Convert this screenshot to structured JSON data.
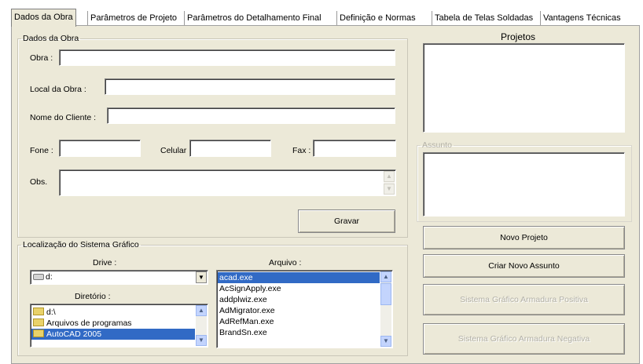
{
  "tabs": [
    {
      "label": "Dados da Obra",
      "active": true
    },
    {
      "label": "Parâmetros de Projeto"
    },
    {
      "label": "Parâmetros do Detalhamento Final"
    },
    {
      "label": "Definição e Normas"
    },
    {
      "label": "Tabela de Telas Soldadas"
    },
    {
      "label": "Vantagens Técnicas"
    }
  ],
  "obra_group": {
    "legend": "Dados da Obra",
    "obra_label": "Obra :",
    "local_label": "Local da Obra :",
    "cliente_label": "Nome do Cliente :",
    "fone_label": "Fone :",
    "celular_label": "Celular :",
    "fax_label": "Fax :",
    "obs_label": "Obs.",
    "values": {
      "obra": "",
      "local": "",
      "cliente": "",
      "fone": "",
      "celular": "",
      "fax": "",
      "obs": ""
    },
    "gravar_button": "Gravar"
  },
  "localizacao": {
    "legend": "Localização do Sistema Gráfico",
    "drive_label": "Drive :",
    "drive_value": "d:",
    "diretorio_label": "Diretório :",
    "directories": [
      {
        "label": "d:\\",
        "selected": false
      },
      {
        "label": "Arquivos de programas",
        "selected": false
      },
      {
        "label": "AutoCAD 2005",
        "selected": true
      }
    ],
    "arquivo_label": "Arquivo :",
    "files": [
      {
        "label": "acad.exe",
        "selected": true
      },
      {
        "label": "AcSignApply.exe",
        "selected": false
      },
      {
        "label": "addplwiz.exe",
        "selected": false
      },
      {
        "label": "AdMigrator.exe",
        "selected": false
      },
      {
        "label": "AdRefMan.exe",
        "selected": false
      },
      {
        "label": "BrandSn.exe",
        "selected": false
      }
    ]
  },
  "right": {
    "projetos_title": "Projetos",
    "assunto_legend": "Assunto",
    "novo_projeto_button": "Novo Projeto",
    "criar_assunto_button": "Criar Novo Assunto",
    "armadura_positiva_button": "Sistema Gráfico  Armadura Positiva",
    "armadura_negativa_button": "Sistema Gráfico  Armadura Negativa"
  },
  "icons": {
    "scroll_up": "up-arrow-icon",
    "scroll_down": "down-arrow-icon",
    "dropdown": "dropdown-arrow-icon"
  }
}
